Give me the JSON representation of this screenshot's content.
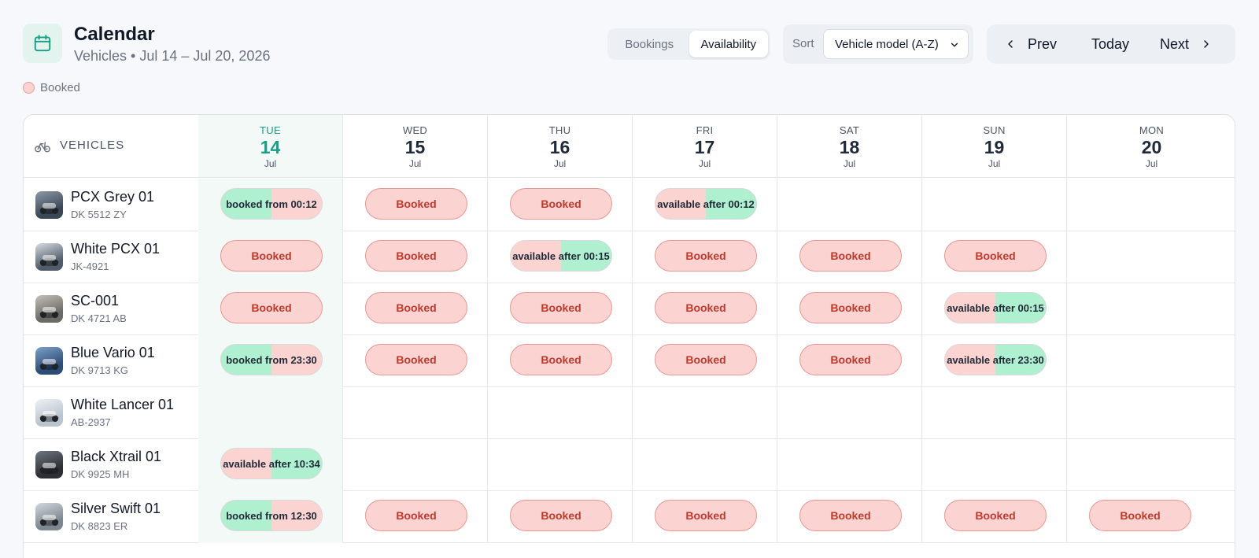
{
  "header": {
    "title": "Calendar",
    "subtitle": "Vehicles • Jul 14 – Jul 20, 2026",
    "view_toggle": {
      "bookings": "Bookings",
      "availability": "Availability",
      "active": "availability"
    },
    "sort": {
      "label": "Sort",
      "value": "Vehicle model (A-Z)"
    },
    "nav": {
      "prev": "Prev",
      "today": "Today",
      "next": "Next"
    }
  },
  "legend": {
    "booked": "Booked"
  },
  "grid": {
    "vehicles_header": "VEHICLES",
    "days": [
      {
        "dow": "TUE",
        "num": "14",
        "mon": "Jul",
        "today": true
      },
      {
        "dow": "WED",
        "num": "15",
        "mon": "Jul"
      },
      {
        "dow": "THU",
        "num": "16",
        "mon": "Jul"
      },
      {
        "dow": "FRI",
        "num": "17",
        "mon": "Jul"
      },
      {
        "dow": "SAT",
        "num": "18",
        "mon": "Jul"
      },
      {
        "dow": "SUN",
        "num": "19",
        "mon": "Jul"
      },
      {
        "dow": "MON",
        "num": "20",
        "mon": "Jul"
      }
    ],
    "rows": [
      {
        "name": "PCX Grey 01",
        "plate": "DK 5512 ZY",
        "cells": [
          {
            "type": "split-bf",
            "text": "booked from 00:12"
          },
          {
            "type": "booked",
            "text": "Booked"
          },
          {
            "type": "booked",
            "text": "Booked"
          },
          {
            "type": "split-af",
            "text": "available after 00:12"
          },
          null,
          null,
          null
        ]
      },
      {
        "name": "White PCX 01",
        "plate": "JK-4921",
        "cells": [
          {
            "type": "booked",
            "text": "Booked"
          },
          {
            "type": "booked",
            "text": "Booked"
          },
          {
            "type": "split-af",
            "text": "available after 00:15"
          },
          {
            "type": "booked",
            "text": "Booked"
          },
          {
            "type": "booked",
            "text": "Booked"
          },
          {
            "type": "booked",
            "text": "Booked"
          },
          null
        ]
      },
      {
        "name": "SC-001",
        "plate": "DK 4721 AB",
        "cells": [
          {
            "type": "booked",
            "text": "Booked"
          },
          {
            "type": "booked",
            "text": "Booked"
          },
          {
            "type": "booked",
            "text": "Booked"
          },
          {
            "type": "booked",
            "text": "Booked"
          },
          {
            "type": "booked",
            "text": "Booked"
          },
          {
            "type": "split-af",
            "text": "available after 00:15"
          },
          null
        ]
      },
      {
        "name": "Blue Vario 01",
        "plate": "DK 9713 KG",
        "cells": [
          {
            "type": "split-bf",
            "text": "booked from 23:30"
          },
          {
            "type": "booked",
            "text": "Booked"
          },
          {
            "type": "booked",
            "text": "Booked"
          },
          {
            "type": "booked",
            "text": "Booked"
          },
          {
            "type": "booked",
            "text": "Booked"
          },
          {
            "type": "split-af",
            "text": "available after 23:30"
          },
          null
        ]
      },
      {
        "name": "White Lancer 01",
        "plate": "AB-2937",
        "cells": [
          null,
          null,
          null,
          null,
          null,
          null,
          null
        ]
      },
      {
        "name": "Black Xtrail 01",
        "plate": "DK 9925 MH",
        "cells": [
          {
            "type": "split-af",
            "text": "available after 10:34"
          },
          null,
          null,
          null,
          null,
          null,
          null
        ]
      },
      {
        "name": "Silver Swift 01",
        "plate": "DK 8823 ER",
        "cells": [
          {
            "type": "split-bf",
            "text": "booked from 12:30"
          },
          {
            "type": "booked",
            "text": "Booked"
          },
          {
            "type": "booked",
            "text": "Booked"
          },
          {
            "type": "booked",
            "text": "Booked"
          },
          {
            "type": "booked",
            "text": "Booked"
          },
          {
            "type": "booked",
            "text": "Booked"
          },
          {
            "type": "booked",
            "text": "Booked"
          }
        ]
      }
    ]
  },
  "icons": {
    "app": "calendar-icon",
    "vehicles": "bicycle-icon",
    "prev": "chevron-left-icon",
    "next": "chevron-right-icon",
    "sort": "chevron-down-icon"
  },
  "colors": {
    "accent": "#16a085",
    "booked_fill": "#fbd3d1",
    "booked_text": "#c0392b",
    "available_fill": "#aef0cf"
  }
}
